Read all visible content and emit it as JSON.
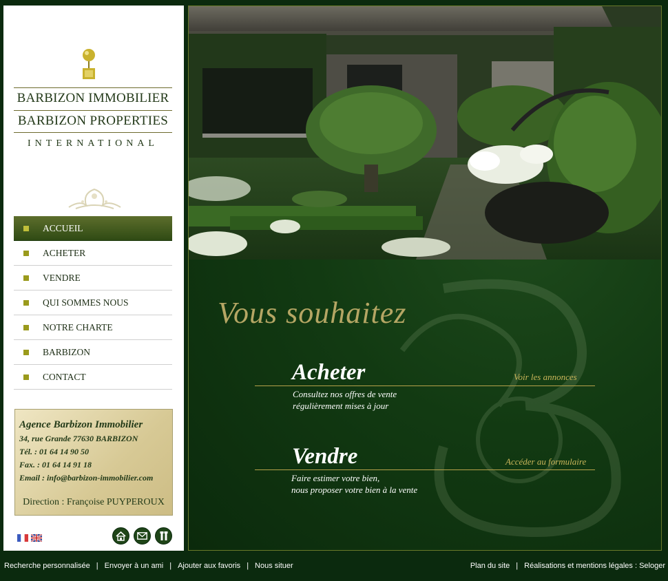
{
  "brand": {
    "title": "BARBIZON IMMOBILIER",
    "subtitle": "BARBIZON PROPERTIES",
    "international": "INTERNATIONAL"
  },
  "nav": [
    {
      "label": "ACCUEIL",
      "active": true
    },
    {
      "label": "ACHETER",
      "active": false
    },
    {
      "label": "VENDRE",
      "active": false
    },
    {
      "label": "QUI SOMMES NOUS",
      "active": false
    },
    {
      "label": "NOTRE CHARTE",
      "active": false
    },
    {
      "label": "BARBIZON",
      "active": false
    },
    {
      "label": "CONTACT",
      "active": false
    }
  ],
  "agency": {
    "name": "Agence Barbizon Immobilier",
    "address": "34, rue Grande 77630 BARBIZON",
    "tel": "Tél. : 01 64 14 90 50",
    "fax": "Fax. : 01 64 14 91 18",
    "email": "Email : info@barbizon-immobilier.com",
    "direction": "Direction : Françoise PUYPEROUX"
  },
  "main": {
    "headline": "Vous souhaitez",
    "sections": [
      {
        "title": "Acheter",
        "link": "Voir les annonces",
        "desc1": "Consultez nos offres de vente",
        "desc2": "régulièrement mises à jour"
      },
      {
        "title": "Vendre",
        "link": "Accéder au formulaire",
        "desc1": "Faire estimer votre bien,",
        "desc2": "nous proposer votre bien à la vente"
      }
    ]
  },
  "footer": {
    "left": [
      "Recherche personnalisée",
      "Envoyer à un ami",
      "Ajouter aux favoris",
      "Nous situer"
    ],
    "right": [
      "Plan du site",
      "Réalisations et mentions légales : Seloger"
    ],
    "separator": "|"
  },
  "icons": [
    "home-icon",
    "mail-icon",
    "tools-icon"
  ],
  "colors": {
    "background": "#0b2a0e",
    "accent_gold": "#b5a664",
    "nav_active": "#3f5a1c"
  }
}
